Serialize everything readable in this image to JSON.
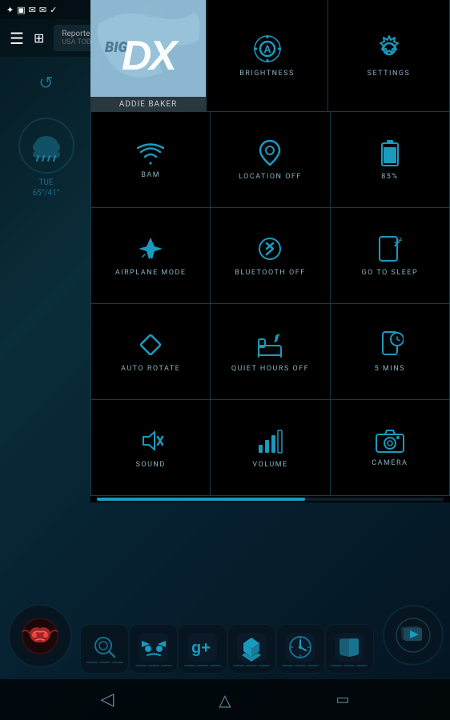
{
  "statusBar": {
    "icons": [
      "dropbox",
      "image",
      "gmail",
      "email",
      "shield"
    ]
  },
  "notification": {
    "title": "Reporter can...",
    "source": "USA TODAY"
  },
  "sidebar": {
    "day": "TUE",
    "temp": "65°/41°"
  },
  "userHeader": {
    "avatarText": "DX",
    "name": "ADDIE BAKER"
  },
  "tiles": [
    {
      "id": "brightness",
      "label": "BRIGHTNESS",
      "icon": "brightness"
    },
    {
      "id": "settings",
      "label": "SETTINGS",
      "icon": "settings"
    },
    {
      "id": "bam",
      "label": "BAM",
      "icon": "wifi"
    },
    {
      "id": "location",
      "label": "LOCATION OFF",
      "icon": "location"
    },
    {
      "id": "battery",
      "label": "85%",
      "icon": "battery"
    },
    {
      "id": "airplane",
      "label": "AIRPLANE MODE",
      "icon": "airplane"
    },
    {
      "id": "bluetooth",
      "label": "BLUETOOTH OFF",
      "icon": "bluetooth"
    },
    {
      "id": "sleep",
      "label": "GO TO SLEEP",
      "icon": "sleep"
    },
    {
      "id": "rotate",
      "label": "AUTO ROTATE",
      "icon": "rotate"
    },
    {
      "id": "quiet",
      "label": "QUIET HOURS OFF",
      "icon": "quiet"
    },
    {
      "id": "timer",
      "label": "5 MINS",
      "icon": "timer"
    },
    {
      "id": "sound",
      "label": "SOUND",
      "icon": "sound"
    },
    {
      "id": "volume",
      "label": "VOLUME",
      "icon": "volume"
    },
    {
      "id": "camera",
      "label": "CAMERA",
      "icon": "camera"
    }
  ],
  "navBar": {
    "back": "◁",
    "home": "△",
    "recent": "□"
  },
  "dock": {
    "apps": [
      {
        "id": "search",
        "icon": "○",
        "color": "#1a6e8a"
      },
      {
        "id": "villain",
        "icon": "⚡",
        "color": "#1a9abe"
      },
      {
        "id": "gplus",
        "icon": "g+",
        "color": "#1a9abe"
      },
      {
        "id": "dropbox",
        "icon": "◇",
        "color": "#1a9abe"
      },
      {
        "id": "clock",
        "icon": "⌚",
        "color": "#1a6e8a"
      },
      {
        "id": "book",
        "icon": "📖",
        "color": "#1a6e8a"
      }
    ]
  },
  "colors": {
    "accent": "#1a9abe",
    "accentDark": "#1a6e8a",
    "bg": "#051a22",
    "tileBg": "#000000",
    "tileLabel": "#8ab0c0",
    "border": "#1a3a4a"
  }
}
